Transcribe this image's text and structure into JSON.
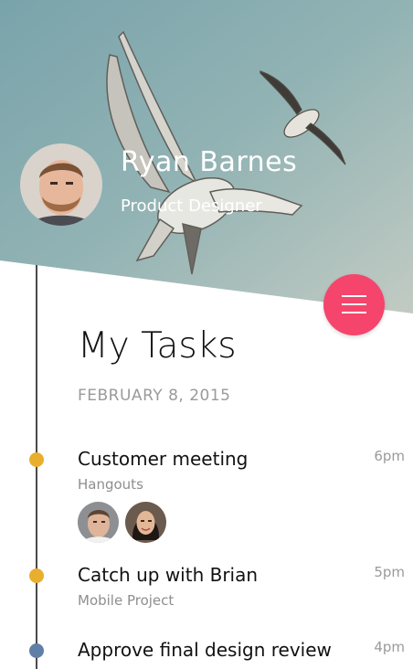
{
  "profile": {
    "name": "Ryan Barnes",
    "role": "Product Designer"
  },
  "page": {
    "title": "My Tasks",
    "date": "FEBRUARY 8, 2015"
  },
  "menu_icon": "hamburger-menu-icon",
  "colors": {
    "accent": "#f5456c",
    "dot_orange": "#e8ae2d",
    "dot_blue": "#5f7fa6"
  },
  "tasks": [
    {
      "title": "Customer meeting",
      "subtitle": "Hangouts",
      "time": "6pm",
      "dot_color": "#e8ae2d"
    },
    {
      "title": "Catch up with Brian",
      "subtitle": "Mobile Project",
      "time": "5pm",
      "dot_color": "#e8ae2d"
    },
    {
      "title": "Approve final design review",
      "subtitle": "",
      "time": "4pm",
      "dot_color": "#5f7fa6"
    }
  ]
}
